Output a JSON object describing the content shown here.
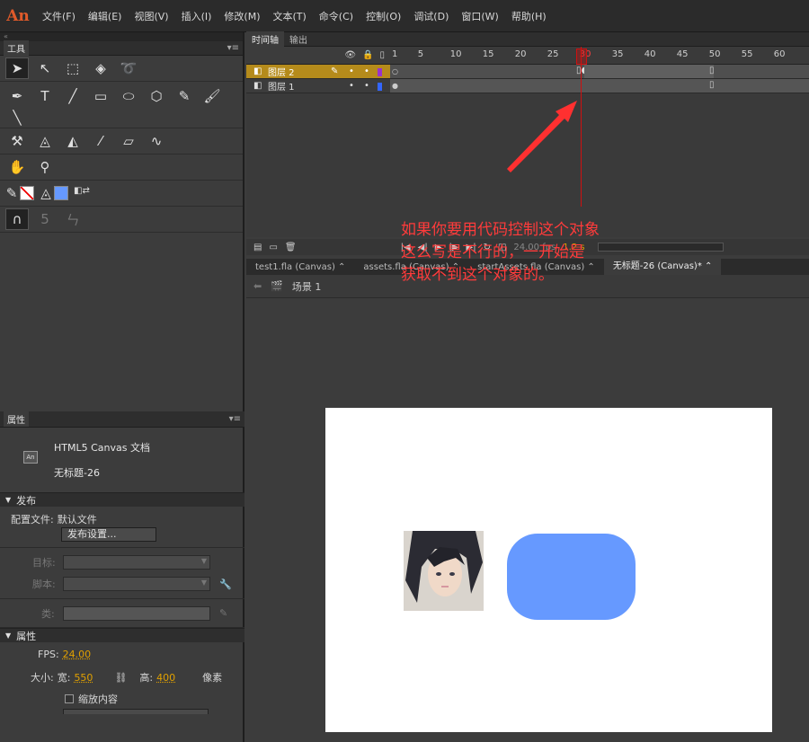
{
  "app": {
    "logo": "An",
    "menu": [
      "文件(F)",
      "编辑(E)",
      "视图(V)",
      "插入(I)",
      "修改(M)",
      "文本(T)",
      "命令(C)",
      "控制(O)",
      "调试(D)",
      "窗口(W)",
      "帮助(H)"
    ]
  },
  "tools_panel": {
    "tab": "工具",
    "menu_glyph": "▾≡"
  },
  "properties": {
    "tab": "属性",
    "doc_icon": "An",
    "doc_type": "HTML5 Canvas 文档",
    "doc_name": "无标题-26",
    "publish_section": "发布",
    "profile_label": "配置文件:",
    "profile_value": "默认文件",
    "publish_settings_button": "发布设置...",
    "target_label": "目标:",
    "script_label": "脚本:",
    "class_label": "类:",
    "props_section": "属性",
    "fps_label": "FPS:",
    "fps_value": "24.00",
    "size_label": "大小:",
    "width_label": "宽:",
    "width_value": "550",
    "height_label": "高:",
    "height_value": "400",
    "unit": "像素",
    "scale_content_label": "缩放内容"
  },
  "timeline": {
    "tabs": [
      "时间轴",
      "输出"
    ],
    "active_tab": "时间轴",
    "ruler_labels": [
      "1",
      "5",
      "10",
      "15",
      "20",
      "25",
      "30",
      "35",
      "40",
      "45",
      "50",
      "55",
      "60"
    ],
    "current_frame": 30,
    "layers": [
      {
        "name": "图层 2",
        "active": true,
        "color": "#9933cc"
      },
      {
        "name": "图层 1",
        "active": false,
        "color": "#3366ff"
      }
    ],
    "controls": {
      "fps_readout": "24.00 fps",
      "time_readout": "1.2 s"
    }
  },
  "documents": {
    "tabs": [
      {
        "label": "test1.fla (Canvas)",
        "active": false
      },
      {
        "label": "assets.fla (Canvas)",
        "active": false
      },
      {
        "label": "startAssets.fla (Canvas)",
        "active": false
      },
      {
        "label": "无标题-26 (Canvas)*",
        "active": true
      }
    ],
    "scene": "场景 1"
  },
  "annotation": {
    "lines": [
      "如果你要用代码控制这个对象",
      "这么写是不行的，一开始是",
      "获取不到这个对象的。"
    ],
    "color": "#ff3b3b"
  },
  "stage": {
    "background": "#ffffff",
    "shape_color": "#6699ff"
  }
}
